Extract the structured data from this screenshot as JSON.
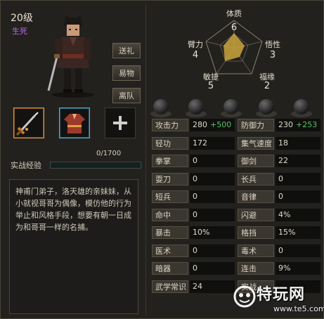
{
  "character": {
    "level": "20级",
    "realm": "生死"
  },
  "actions": [
    "送礼",
    "易物",
    "离队"
  ],
  "equipment": [
    {
      "icon": "sword-icon"
    },
    {
      "icon": "robe-icon"
    },
    {
      "icon": "add-icon"
    }
  ],
  "experience": {
    "label": "实战经验",
    "value": "0/1700",
    "progress": 0
  },
  "description": "神甫门弟子，洛天雄的亲妹妹，从小就视哥哥为偶像，模仿他的行为举止和风格手段，想要有朝一日成为和哥哥一样的名捕。",
  "radar": {
    "labels": [
      {
        "name": "体质",
        "value": "6"
      },
      {
        "name": "悟性",
        "value": "3"
      },
      {
        "name": "福缘",
        "value": "2"
      },
      {
        "name": "敏捷",
        "value": "5"
      },
      {
        "name": "臂力",
        "value": "4"
      }
    ],
    "fill_color": "#c9a43c"
  },
  "stats_left": [
    {
      "name": "攻击力",
      "value": "280",
      "bonus": "+500"
    },
    {
      "name": "轻功",
      "value": "172"
    },
    {
      "name": "拳掌",
      "value": "0"
    },
    {
      "name": "耍刀",
      "value": "0"
    },
    {
      "name": "短兵",
      "value": "0"
    },
    {
      "name": "命中",
      "value": "0"
    },
    {
      "name": "暴击",
      "value": "10%"
    },
    {
      "name": "医术",
      "value": "0"
    },
    {
      "name": "暗器",
      "value": "0"
    },
    {
      "name": "武学常识",
      "value": "24"
    }
  ],
  "stats_right": [
    {
      "name": "防御力",
      "value": "230",
      "bonus": "+253"
    },
    {
      "name": "集气速度",
      "value": "18"
    },
    {
      "name": "御剑",
      "value": "22"
    },
    {
      "name": "长兵",
      "value": "0"
    },
    {
      "name": "音律",
      "value": "0"
    },
    {
      "name": "闪避",
      "value": "4%"
    },
    {
      "name": "格挡",
      "value": "15%"
    },
    {
      "name": "毒术",
      "value": "0"
    },
    {
      "name": "连击",
      "value": "9%"
    },
    {
      "name": "实战",
      "value": ""
    }
  ],
  "watermark": {
    "main": "特玩网",
    "url": "www.te5.com"
  }
}
